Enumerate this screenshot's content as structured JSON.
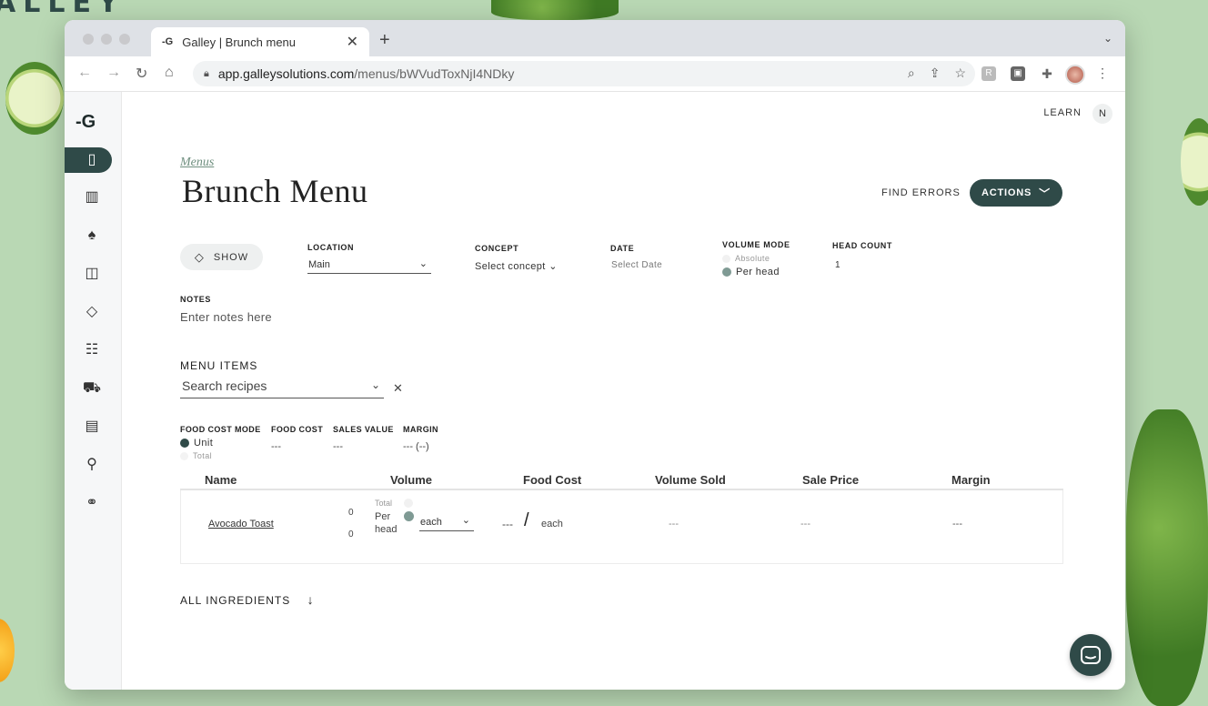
{
  "background": {
    "brand_text": "ALLEY"
  },
  "browser": {
    "tab_title": "Galley | Brunch menu",
    "url_host": "app.galleysolutions.com",
    "url_path": "/menus/bWVudToxNjI4NDky"
  },
  "header": {
    "learn_label": "LEARN",
    "user_initial": "N"
  },
  "page": {
    "breadcrumb": "Menus",
    "title": "Brunch Menu",
    "find_errors_label": "FIND ERRORS",
    "actions_label": "ACTIONS"
  },
  "filters": {
    "show_label": "SHOW",
    "location": {
      "label": "LOCATION",
      "value": "Main"
    },
    "concept": {
      "label": "CONCEPT",
      "placeholder": "Select concept"
    },
    "date": {
      "label": "DATE",
      "placeholder": "Select Date"
    },
    "volume_mode": {
      "label": "VOLUME MODE",
      "options": [
        "Absolute",
        "Per head"
      ],
      "selected": "Per head"
    },
    "head_count": {
      "label": "HEAD COUNT",
      "value": "1"
    }
  },
  "notes": {
    "label": "NOTES",
    "placeholder": "Enter notes here"
  },
  "menu_items": {
    "title": "MENU ITEMS",
    "search_placeholder": "Search recipes"
  },
  "summary": {
    "food_cost_mode": {
      "label": "FOOD COST MODE",
      "options": [
        "Unit",
        "Total"
      ],
      "selected": "Unit"
    },
    "food_cost": {
      "label": "FOOD COST",
      "value": "---"
    },
    "sales_value": {
      "label": "SALES VALUE",
      "value": "---"
    },
    "margin": {
      "label": "MARGIN",
      "value": "--- (--)"
    }
  },
  "table": {
    "columns": [
      "Name",
      "Volume",
      "Food Cost",
      "Volume Sold",
      "Sale Price",
      "Margin"
    ],
    "rows": [
      {
        "name": "Avocado Toast",
        "volume_top": "0",
        "volume_bottom": "0",
        "mode_total": "Total",
        "mode_per_head": "Per head",
        "unit": "each",
        "food_cost": "---",
        "food_cost_sep": "/",
        "food_cost_unit": "each",
        "volume_sold": "---",
        "sale_price": "---",
        "margin": "---"
      }
    ]
  },
  "footer": {
    "all_ingredients_label": "ALL INGREDIENTS"
  },
  "colors": {
    "brand": "#2f4a48",
    "background": "#b9d8b4",
    "accent_muted": "#6f8f7f"
  }
}
